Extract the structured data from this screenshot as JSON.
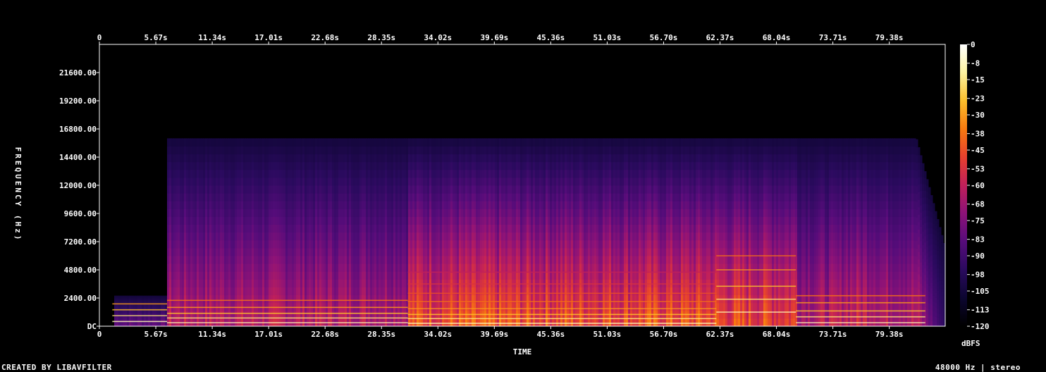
{
  "chart_data": {
    "type": "heatmap",
    "title": "",
    "xlabel": "TIME",
    "ylabel": "FREQUENCY (Hz)",
    "x_ticks_top": [
      "0",
      "5.67s",
      "11.34s",
      "17.01s",
      "22.68s",
      "28.35s",
      "34.02s",
      "39.69s",
      "45.36s",
      "51.03s",
      "56.70s",
      "62.37s",
      "68.04s",
      "73.71s",
      "79.38s"
    ],
    "x_ticks_bottom": [
      "0",
      "5.67s",
      "11.34s",
      "17.01s",
      "22.68s",
      "28.35s",
      "34.02s",
      "39.69s",
      "45.36s",
      "51.03s",
      "56.70s",
      "62.37s",
      "68.04s",
      "73.71s",
      "79.38s"
    ],
    "y_ticks": [
      "DC",
      "2400.00",
      "4800.00",
      "7200.00",
      "9600.00",
      "12000.00",
      "14400.00",
      "16800.00",
      "19200.00",
      "21600.00"
    ],
    "y_values": [
      0,
      2400,
      4800,
      7200,
      9600,
      12000,
      14400,
      16800,
      19200,
      21600
    ],
    "xlim": [
      0,
      85.0
    ],
    "ylim": [
      0,
      24000
    ],
    "x_tick_step_s": 5.67,
    "colorbar": {
      "label": "dBFS",
      "ticks": [
        "0",
        "-8",
        "-15",
        "-23",
        "-30",
        "-38",
        "-45",
        "-53",
        "-60",
        "-68",
        "-75",
        "-83",
        "-90",
        "-98",
        "-105",
        "-113",
        "-120"
      ],
      "values": [
        0,
        -8,
        -15,
        -23,
        -30,
        -38,
        -45,
        -53,
        -60,
        -68,
        -75,
        -83,
        -90,
        -98,
        -105,
        -113,
        -120
      ],
      "range": [
        -120,
        0
      ],
      "colors": [
        "#000000",
        "#0c0630",
        "#2a0a5e",
        "#560c7a",
        "#8c1278",
        "#c0205a",
        "#e6402e",
        "#f87a10",
        "#fbbf2c",
        "#fdf3a0",
        "#ffffff"
      ]
    },
    "energy_cutoff_hz": 16000,
    "grid": false
  },
  "footer": {
    "left": "CREATED BY LIBAVFILTER",
    "right": "48000 Hz | stereo"
  }
}
